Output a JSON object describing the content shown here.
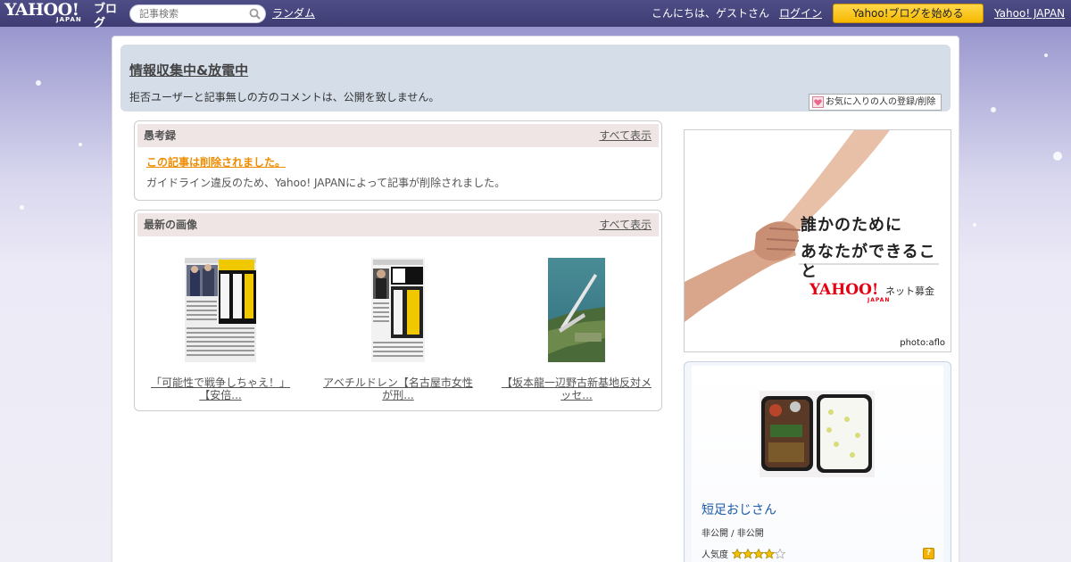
{
  "masthead": {
    "logo_text": "YAHOO!",
    "logo_sub": "JAPAN",
    "logo_blog": "ブログ",
    "search_placeholder": "記事検索",
    "random_link": "ランダム",
    "greeting": "こんにちは、ゲストさん",
    "login_link": "ログイン",
    "start_button": "Yahoo!ブログを始める",
    "yahoo_japan_link": "Yahoo! JAPAN"
  },
  "blog_header": {
    "title": "情報収集中&放電中",
    "description": "拒否ユーザーと記事無しの方のコメントは、公開を致しません。",
    "favorite_button": "お気に入りの人の登録/削除"
  },
  "recent_articles": {
    "heading": "愚考録",
    "more_link": "すべて表示",
    "deleted_title": "この記事は削除されました。",
    "deleted_description": "ガイドライン違反のため、Yahoo! JAPANによって記事が削除されました。"
  },
  "latest_images": {
    "heading": "最新の画像",
    "more_link": "すべて表示",
    "items": [
      {
        "caption_line1": "「可能性で戦争しちゃえ！」",
        "caption_line2": "【安倍..."
      },
      {
        "caption_line1": "アベチルドレン【名古屋市女性",
        "caption_line2": "が刑..."
      },
      {
        "caption_line1": "【坂本龍一辺野古新基地反対メ",
        "caption_line2": "ッセ..."
      }
    ]
  },
  "ad": {
    "line1": "誰かのために",
    "line2": "あなたができること",
    "brand": "YAHOO!",
    "brand_sub": "JAPAN",
    "service": "ネット募金",
    "credit": "photo:aflo"
  },
  "profile": {
    "name": "短足おじさん",
    "status": "非公開 / 非公開",
    "popularity_label": "人気度",
    "popularity_stars": 4,
    "popularity_max": 5
  },
  "colors": {
    "masthead": "#45437b",
    "start_button": "#fcc800",
    "deleted_title": "#f08c00",
    "profile_name": "#1a5aa8",
    "header_bg": "#d4dde8",
    "box_head_bg": "#efe5e5"
  }
}
